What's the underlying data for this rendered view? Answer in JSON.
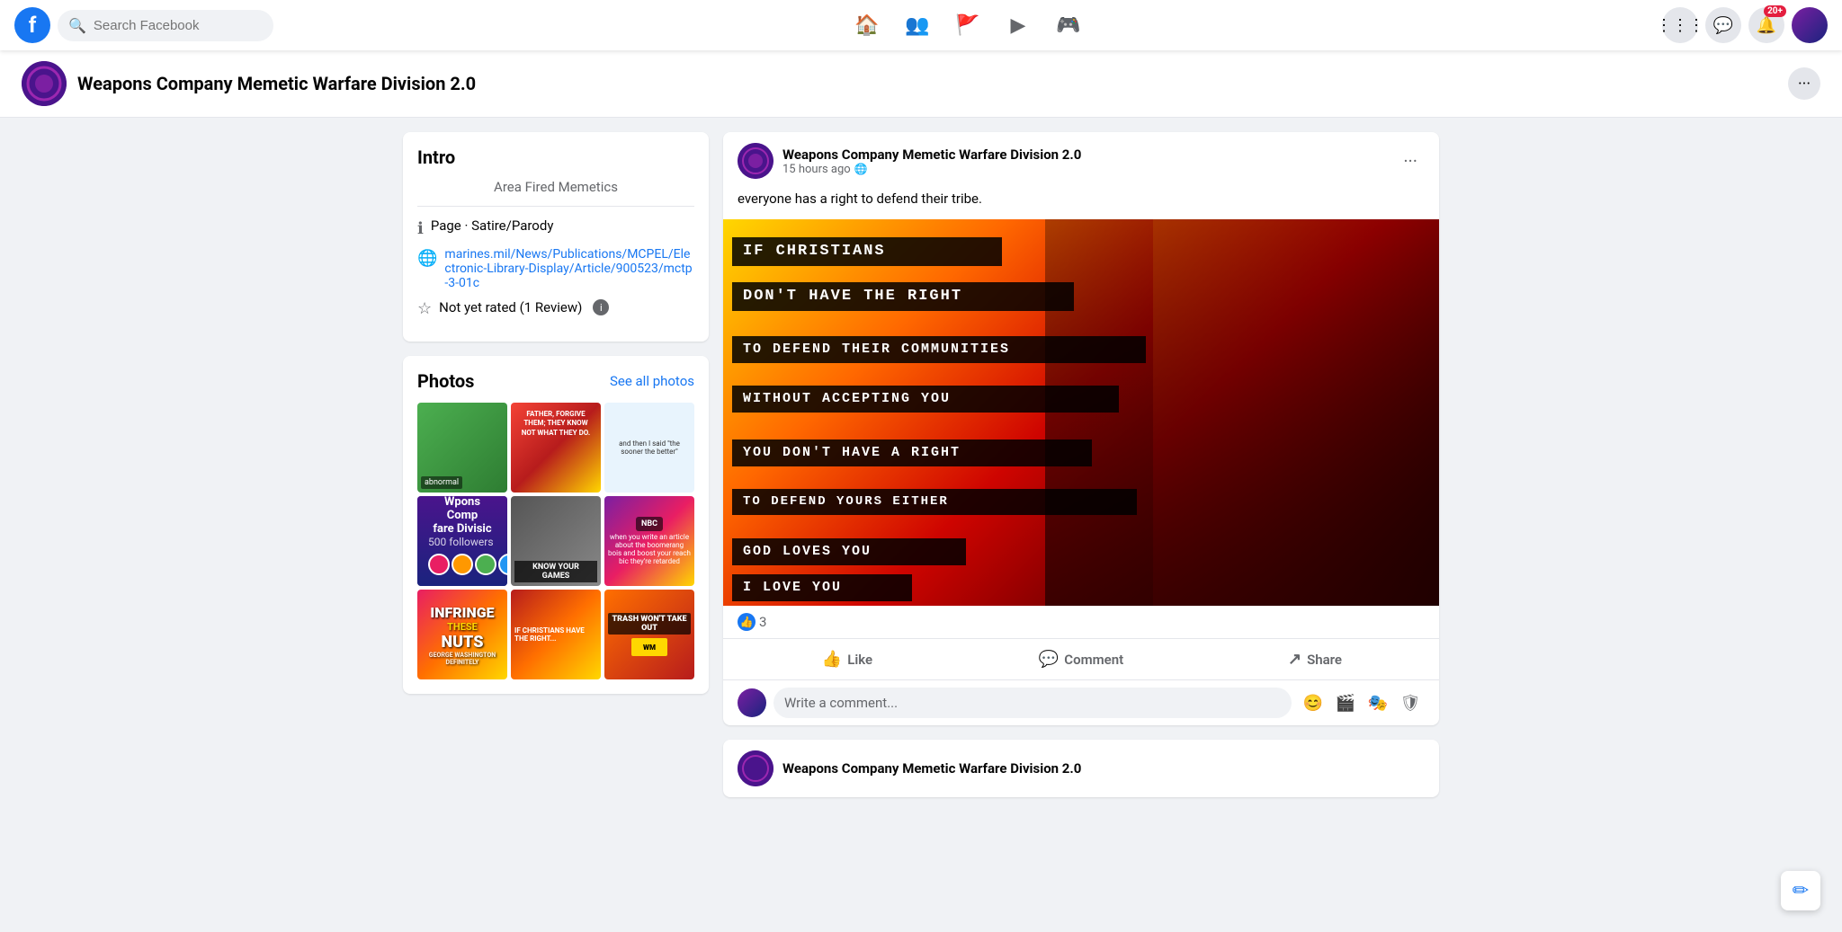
{
  "app": {
    "name": "Facebook",
    "logo": "f"
  },
  "nav": {
    "search_placeholder": "Search Facebook",
    "icons": [
      "home",
      "friends",
      "flag",
      "video",
      "gaming"
    ],
    "action_icons": [
      "grid",
      "messenger",
      "bell",
      "profile"
    ],
    "notif_count": "20+"
  },
  "page_header": {
    "title": "Weapons Company Memetic Warfare Division 2.0",
    "more_label": "···"
  },
  "intro": {
    "title": "Intro",
    "tagline": "Area Fired Memetics",
    "category": "Page · Satire/Parody",
    "link": "marines.mil/News/Publications/MCPEL/Electronic-Library-Display/Article/900523/mctp-3-01c",
    "rating": "Not yet rated (1 Review)"
  },
  "photos": {
    "title": "Photos",
    "see_all": "See all photos"
  },
  "page_cover": {
    "name": "Wpons Comp\nfare Divisic",
    "followers": "500 followers"
  },
  "post": {
    "page_name": "Weapons Company Memetic Warfare Division 2.0",
    "time": "15 hours ago",
    "privacy": "🌐",
    "text": "everyone has a right to defend their tribe.",
    "meme_lines": [
      "IF CHRISTIANS",
      "DON'T HAVE THE RIGHT",
      "TO DEFEND THEIR COMMUNITIES",
      "WITHOUT ACCEPTING YOU",
      "YOU DON'T HAVE A RIGHT",
      "TO DEFEND YOURS EITHER",
      "GOD LOVES YOU",
      "I LOVE YOU"
    ],
    "reaction_count": "3",
    "actions": {
      "like": "Like",
      "comment": "Comment",
      "share": "Share"
    },
    "comment_placeholder": "Write a comment...",
    "more_label": "···"
  },
  "next_post": {
    "page_name": "Weapons Company Memetic Warfare Division 2.0"
  }
}
